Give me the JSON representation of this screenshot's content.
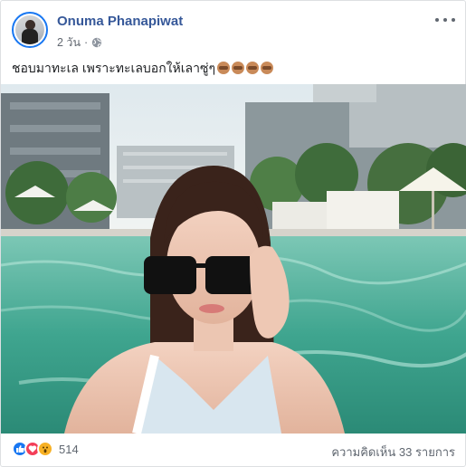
{
  "post": {
    "author": "Onuma Phanapiwat",
    "time": "2 วัน",
    "time_separator": "·",
    "audience_icon": "globe-icon",
    "text": "ชอบมาทะเล เพราะทะเลบอกให้เลาซู่ๆ",
    "emoji_icons": [
      "see-no-evil-monkey-emoji",
      "see-no-evil-monkey-emoji",
      "see-no-evil-monkey-emoji",
      "see-no-evil-monkey-emoji"
    ],
    "photo_description_icon": "pool-selfie-photo"
  },
  "menu": {
    "icon": "more-options-icon"
  },
  "reactions": {
    "icons": [
      "like-icon",
      "love-icon",
      "wow-icon"
    ],
    "count": "514"
  },
  "comments": {
    "label": "ความคิดเห็น 33 รายการ"
  },
  "colors": {
    "name_link": "#365899",
    "like": "#1877f2",
    "love": "#f33e58",
    "wow": "#f7b125",
    "water": "#3fa58f"
  }
}
